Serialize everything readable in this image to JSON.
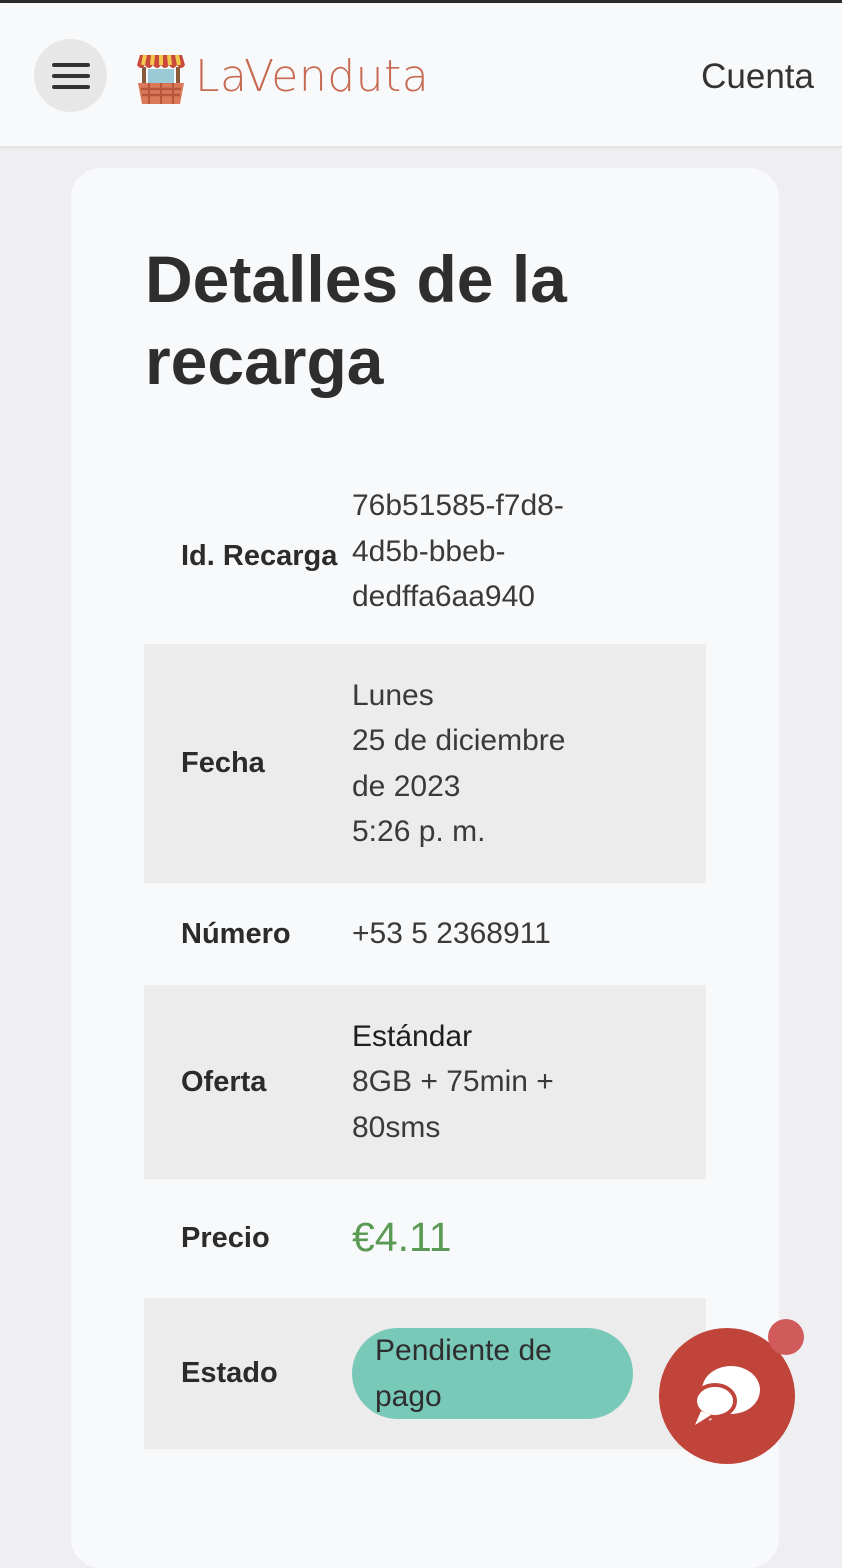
{
  "header": {
    "menu_icon": "hamburger-menu-icon",
    "brand_name": "LaVenduta",
    "brand_icon": "market-stall-icon",
    "account_label": "Cuenta"
  },
  "page": {
    "title": "Detalles de la recarga"
  },
  "details": {
    "id": {
      "label": "Id. Recarga",
      "lines": [
        "76b51585-f7d8-",
        "4d5b-bbeb-",
        "dedffa6aa940"
      ]
    },
    "date": {
      "label": "Fecha",
      "lines": [
        "Lunes",
        "25 de diciembre",
        "de 2023",
        "5:26 p. m."
      ]
    },
    "number": {
      "label": "Número",
      "value": "+53 5 2368911"
    },
    "offer": {
      "label": "Oferta",
      "lines": [
        "Estándar",
        "8GB + 75min +",
        "80sms"
      ]
    },
    "price": {
      "label": "Precio",
      "value": "€4.11"
    },
    "status": {
      "label": "Estado",
      "value": "Pendiente de pago"
    }
  },
  "chat": {
    "icon": "chat-bubbles-icon"
  },
  "colors": {
    "brand": "#c76a52",
    "price": "#5b9a55",
    "status_badge": "#79c9b9",
    "chat_button": "#c0443a",
    "notification_dot": "#d15a5a"
  }
}
